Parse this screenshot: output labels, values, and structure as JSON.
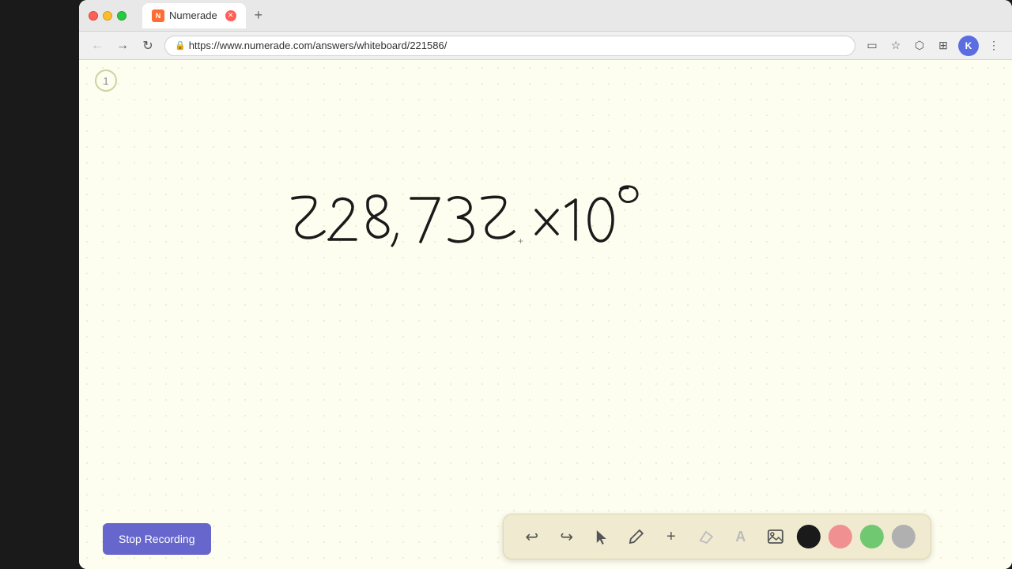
{
  "browser": {
    "tab_label": "Numerade",
    "tab_favicon_text": "N",
    "url": "https://www.numerade.com/answers/whiteboard/221586/",
    "nav": {
      "back_icon": "←",
      "forward_icon": "→",
      "refresh_icon": "↻",
      "lock_icon": "🔒"
    },
    "toolbar": {
      "screen_icon": "▭",
      "star_icon": "☆",
      "extensions_icon": "⬡",
      "sidebar_icon": "⊞",
      "menu_icon": "⋮",
      "user_initial": "K"
    }
  },
  "page_indicator": "1",
  "whiteboard": {
    "bg_color": "#fefef0"
  },
  "bottom_toolbar": {
    "undo_label": "↩",
    "redo_label": "↪",
    "cursor_label": "▲",
    "pen_label": "✏",
    "plus_label": "+",
    "eraser_label": "/",
    "text_label": "A",
    "image_label": "🖼",
    "colors": [
      "#1a1a1a",
      "#f09090",
      "#70c870",
      "#b0b0b0"
    ]
  },
  "stop_recording": {
    "label": "Stop Recording"
  }
}
